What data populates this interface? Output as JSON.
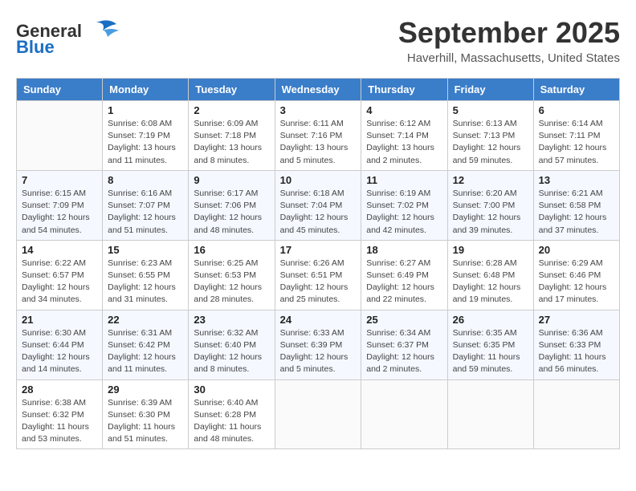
{
  "header": {
    "logo_line1": "General",
    "logo_line2": "Blue",
    "month": "September 2025",
    "location": "Haverhill, Massachusetts, United States"
  },
  "days_of_week": [
    "Sunday",
    "Monday",
    "Tuesday",
    "Wednesday",
    "Thursday",
    "Friday",
    "Saturday"
  ],
  "weeks": [
    [
      {
        "day": "",
        "info": ""
      },
      {
        "day": "1",
        "info": "Sunrise: 6:08 AM\nSunset: 7:19 PM\nDaylight: 13 hours\nand 11 minutes."
      },
      {
        "day": "2",
        "info": "Sunrise: 6:09 AM\nSunset: 7:18 PM\nDaylight: 13 hours\nand 8 minutes."
      },
      {
        "day": "3",
        "info": "Sunrise: 6:11 AM\nSunset: 7:16 PM\nDaylight: 13 hours\nand 5 minutes."
      },
      {
        "day": "4",
        "info": "Sunrise: 6:12 AM\nSunset: 7:14 PM\nDaylight: 13 hours\nand 2 minutes."
      },
      {
        "day": "5",
        "info": "Sunrise: 6:13 AM\nSunset: 7:13 PM\nDaylight: 12 hours\nand 59 minutes."
      },
      {
        "day": "6",
        "info": "Sunrise: 6:14 AM\nSunset: 7:11 PM\nDaylight: 12 hours\nand 57 minutes."
      }
    ],
    [
      {
        "day": "7",
        "info": "Sunrise: 6:15 AM\nSunset: 7:09 PM\nDaylight: 12 hours\nand 54 minutes."
      },
      {
        "day": "8",
        "info": "Sunrise: 6:16 AM\nSunset: 7:07 PM\nDaylight: 12 hours\nand 51 minutes."
      },
      {
        "day": "9",
        "info": "Sunrise: 6:17 AM\nSunset: 7:06 PM\nDaylight: 12 hours\nand 48 minutes."
      },
      {
        "day": "10",
        "info": "Sunrise: 6:18 AM\nSunset: 7:04 PM\nDaylight: 12 hours\nand 45 minutes."
      },
      {
        "day": "11",
        "info": "Sunrise: 6:19 AM\nSunset: 7:02 PM\nDaylight: 12 hours\nand 42 minutes."
      },
      {
        "day": "12",
        "info": "Sunrise: 6:20 AM\nSunset: 7:00 PM\nDaylight: 12 hours\nand 39 minutes."
      },
      {
        "day": "13",
        "info": "Sunrise: 6:21 AM\nSunset: 6:58 PM\nDaylight: 12 hours\nand 37 minutes."
      }
    ],
    [
      {
        "day": "14",
        "info": "Sunrise: 6:22 AM\nSunset: 6:57 PM\nDaylight: 12 hours\nand 34 minutes."
      },
      {
        "day": "15",
        "info": "Sunrise: 6:23 AM\nSunset: 6:55 PM\nDaylight: 12 hours\nand 31 minutes."
      },
      {
        "day": "16",
        "info": "Sunrise: 6:25 AM\nSunset: 6:53 PM\nDaylight: 12 hours\nand 28 minutes."
      },
      {
        "day": "17",
        "info": "Sunrise: 6:26 AM\nSunset: 6:51 PM\nDaylight: 12 hours\nand 25 minutes."
      },
      {
        "day": "18",
        "info": "Sunrise: 6:27 AM\nSunset: 6:49 PM\nDaylight: 12 hours\nand 22 minutes."
      },
      {
        "day": "19",
        "info": "Sunrise: 6:28 AM\nSunset: 6:48 PM\nDaylight: 12 hours\nand 19 minutes."
      },
      {
        "day": "20",
        "info": "Sunrise: 6:29 AM\nSunset: 6:46 PM\nDaylight: 12 hours\nand 17 minutes."
      }
    ],
    [
      {
        "day": "21",
        "info": "Sunrise: 6:30 AM\nSunset: 6:44 PM\nDaylight: 12 hours\nand 14 minutes."
      },
      {
        "day": "22",
        "info": "Sunrise: 6:31 AM\nSunset: 6:42 PM\nDaylight: 12 hours\nand 11 minutes."
      },
      {
        "day": "23",
        "info": "Sunrise: 6:32 AM\nSunset: 6:40 PM\nDaylight: 12 hours\nand 8 minutes."
      },
      {
        "day": "24",
        "info": "Sunrise: 6:33 AM\nSunset: 6:39 PM\nDaylight: 12 hours\nand 5 minutes."
      },
      {
        "day": "25",
        "info": "Sunrise: 6:34 AM\nSunset: 6:37 PM\nDaylight: 12 hours\nand 2 minutes."
      },
      {
        "day": "26",
        "info": "Sunrise: 6:35 AM\nSunset: 6:35 PM\nDaylight: 11 hours\nand 59 minutes."
      },
      {
        "day": "27",
        "info": "Sunrise: 6:36 AM\nSunset: 6:33 PM\nDaylight: 11 hours\nand 56 minutes."
      }
    ],
    [
      {
        "day": "28",
        "info": "Sunrise: 6:38 AM\nSunset: 6:32 PM\nDaylight: 11 hours\nand 53 minutes."
      },
      {
        "day": "29",
        "info": "Sunrise: 6:39 AM\nSunset: 6:30 PM\nDaylight: 11 hours\nand 51 minutes."
      },
      {
        "day": "30",
        "info": "Sunrise: 6:40 AM\nSunset: 6:28 PM\nDaylight: 11 hours\nand 48 minutes."
      },
      {
        "day": "",
        "info": ""
      },
      {
        "day": "",
        "info": ""
      },
      {
        "day": "",
        "info": ""
      },
      {
        "day": "",
        "info": ""
      }
    ]
  ]
}
